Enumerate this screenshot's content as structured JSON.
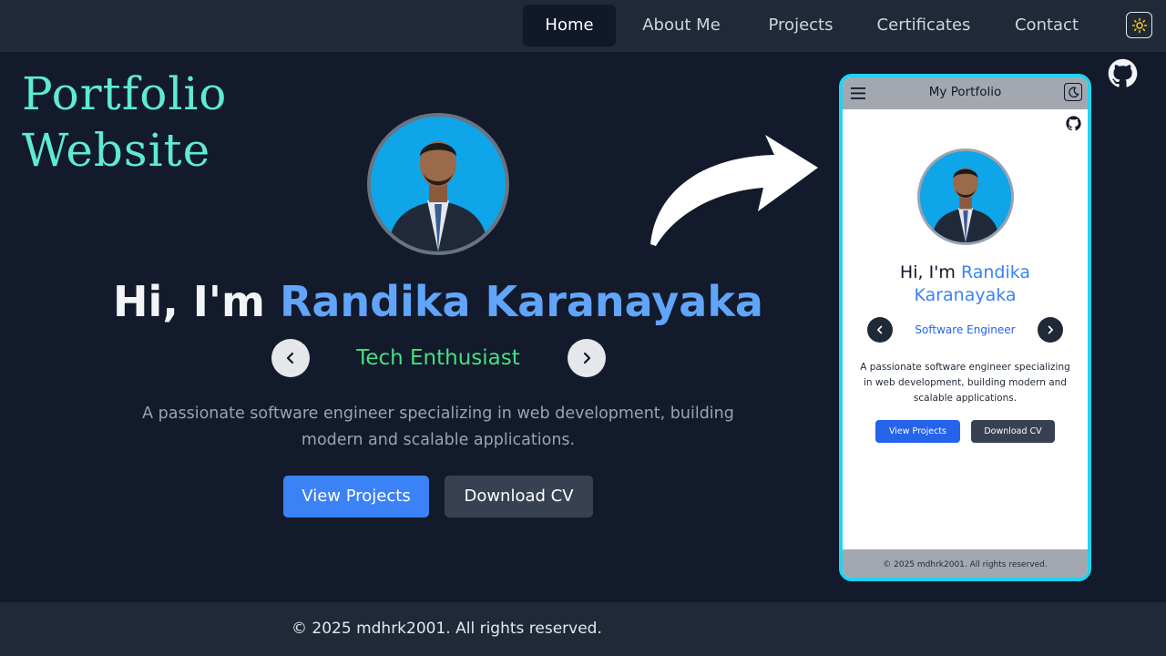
{
  "nav": {
    "items": [
      {
        "label": "Home",
        "active": true
      },
      {
        "label": "About Me",
        "active": false
      },
      {
        "label": "Projects",
        "active": false
      },
      {
        "label": "Certificates",
        "active": false
      },
      {
        "label": "Contact",
        "active": false
      }
    ],
    "theme_icon": "sun-icon"
  },
  "overlay": {
    "title_line1": "Portfolio",
    "title_line2": "Website"
  },
  "hero": {
    "greeting": "Hi, I'm ",
    "name": "Randika Karanayaka",
    "role": "Tech Enthusiast",
    "description": "A passionate software engineer specializing in web development, building modern and scalable applications.",
    "primary_button": "View Projects",
    "secondary_button": "Download CV"
  },
  "footer": {
    "text": "© 2025 mdhrk2001. All rights reserved."
  },
  "mobile": {
    "title": "My Portfolio",
    "greeting": "Hi, I'm ",
    "name_line1": "Randika",
    "name_line2": "Karanayaka",
    "role": "Software Engineer",
    "description": "A passionate software engineer specializing in web development, building modern and scalable applications.",
    "primary_button": "View Projects",
    "secondary_button": "Download CV",
    "footer_text": "© 2025 mdhrk2001. All rights reserved."
  },
  "colors": {
    "accent": "#60a5fa",
    "role": "#4ade80",
    "title": "#5eead4",
    "phone_border": "#22d3ee"
  }
}
